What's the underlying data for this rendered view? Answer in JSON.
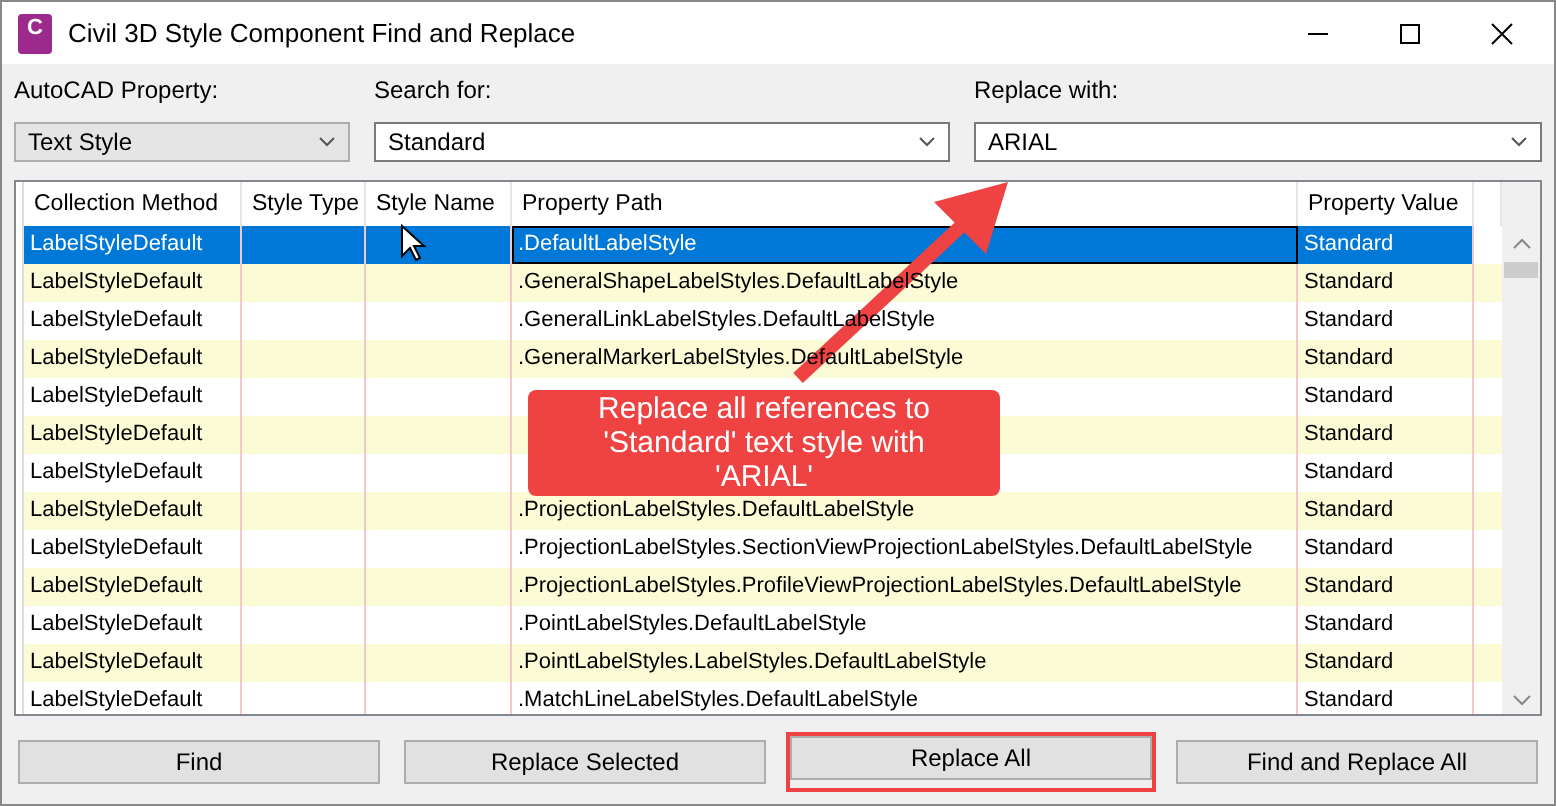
{
  "window": {
    "title": "Civil 3D Style Component Find and Replace",
    "icon_letter": "C"
  },
  "fields": [
    {
      "label": "AutoCAD Property:",
      "value": "Text Style",
      "kind": "dropdown"
    },
    {
      "label": "Search for:",
      "value": "Standard",
      "kind": "combo"
    },
    {
      "label": "Replace with:",
      "value": "ARIAL",
      "kind": "combo"
    }
  ],
  "table": {
    "columns": [
      "Collection Method",
      "Style Type",
      "Style Name",
      "Property Path",
      "Property Value"
    ],
    "rows": [
      {
        "selected": true,
        "cells": [
          "LabelStyleDefault",
          "",
          "",
          ".DefaultLabelStyle",
          "Standard"
        ]
      },
      {
        "selected": false,
        "cells": [
          "LabelStyleDefault",
          "",
          "",
          ".GeneralShapeLabelStyles.DefaultLabelStyle",
          "Standard"
        ]
      },
      {
        "selected": false,
        "cells": [
          "LabelStyleDefault",
          "",
          "",
          ".GeneralLinkLabelStyles.DefaultLabelStyle",
          "Standard"
        ]
      },
      {
        "selected": false,
        "cells": [
          "LabelStyleDefault",
          "",
          "",
          ".GeneralMarkerLabelStyles.DefaultLabelStyle",
          "Standard"
        ]
      },
      {
        "selected": false,
        "cells": [
          "LabelStyleDefault",
          "",
          "",
          "",
          "Standard"
        ]
      },
      {
        "selected": false,
        "cells": [
          "LabelStyleDefault",
          "",
          "",
          "",
          "Standard"
        ]
      },
      {
        "selected": false,
        "cells": [
          "LabelStyleDefault",
          "",
          "",
          "",
          "Standard"
        ]
      },
      {
        "selected": false,
        "cells": [
          "LabelStyleDefault",
          "",
          "",
          ".ProjectionLabelStyles.DefaultLabelStyle",
          "Standard"
        ]
      },
      {
        "selected": false,
        "cells": [
          "LabelStyleDefault",
          "",
          "",
          ".ProjectionLabelStyles.SectionViewProjectionLabelStyles.DefaultLabelStyle",
          "Standard"
        ]
      },
      {
        "selected": false,
        "cells": [
          "LabelStyleDefault",
          "",
          "",
          ".ProjectionLabelStyles.ProfileViewProjectionLabelStyles.DefaultLabelStyle",
          "Standard"
        ]
      },
      {
        "selected": false,
        "cells": [
          "LabelStyleDefault",
          "",
          "",
          ".PointLabelStyles.DefaultLabelStyle",
          "Standard"
        ]
      },
      {
        "selected": false,
        "cells": [
          "LabelStyleDefault",
          "",
          "",
          ".PointLabelStyles.LabelStyles.DefaultLabelStyle",
          "Standard"
        ]
      },
      {
        "selected": false,
        "cells": [
          "LabelStyleDefault",
          "",
          "",
          ".MatchLineLabelStyles.DefaultLabelStyle",
          "Standard"
        ]
      }
    ]
  },
  "buttons": [
    {
      "label": "Find",
      "annotated": false
    },
    {
      "label": "Replace Selected",
      "annotated": false
    },
    {
      "label": "Replace All",
      "annotated": true
    },
    {
      "label": "Find and Replace All",
      "annotated": false
    }
  ],
  "callout": {
    "text": "Replace all references to 'Standard' text style with 'ARIAL'"
  }
}
